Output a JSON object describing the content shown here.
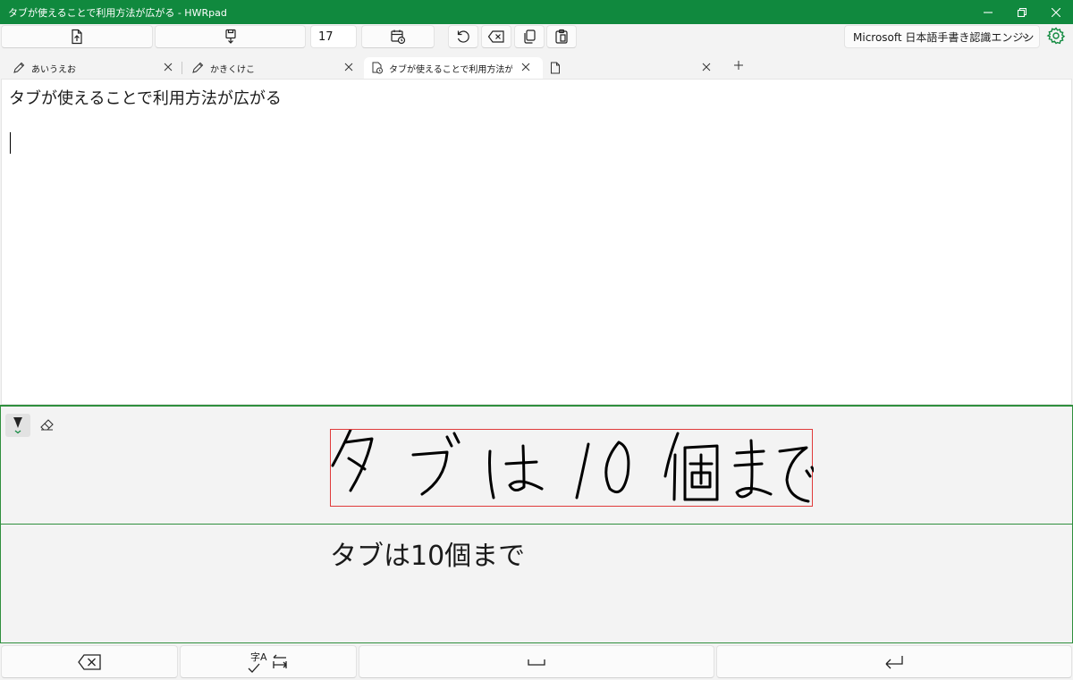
{
  "window": {
    "title": "タブが使えることで利用方法が広がる - HWRpad",
    "accent_color": "#10893e"
  },
  "toolbar": {
    "buttons": [
      {
        "icon": "file-export-icon"
      },
      {
        "icon": "file-save-icon"
      },
      {
        "icon": "calendar-clock-icon"
      },
      {
        "icon": "undo-icon"
      },
      {
        "icon": "backspace-icon"
      },
      {
        "icon": "copy-icon"
      },
      {
        "icon": "paste-icon"
      }
    ],
    "font_size_value": "17",
    "engine_select": "Microsoft 日本語手書き認識エンジン"
  },
  "tabs": [
    {
      "label": "あいうえお",
      "icon": "pencil-icon",
      "active": false
    },
    {
      "label": "かきくけこ",
      "icon": "pencil-icon",
      "active": false
    },
    {
      "label": "タブが使えることで利用方法が広が",
      "icon": "document-clock-icon",
      "active": true
    },
    {
      "label": "",
      "icon": "document-icon",
      "active": false
    }
  ],
  "editor": {
    "line1": "タブが使えることで利用方法が広がる"
  },
  "ink": {
    "tools": [
      "pen-icon",
      "eraser-icon"
    ],
    "box_color": "#e03a3a"
  },
  "recognition": {
    "result": "タブは10個まで"
  },
  "bottom": {
    "convert_label": "字A"
  }
}
